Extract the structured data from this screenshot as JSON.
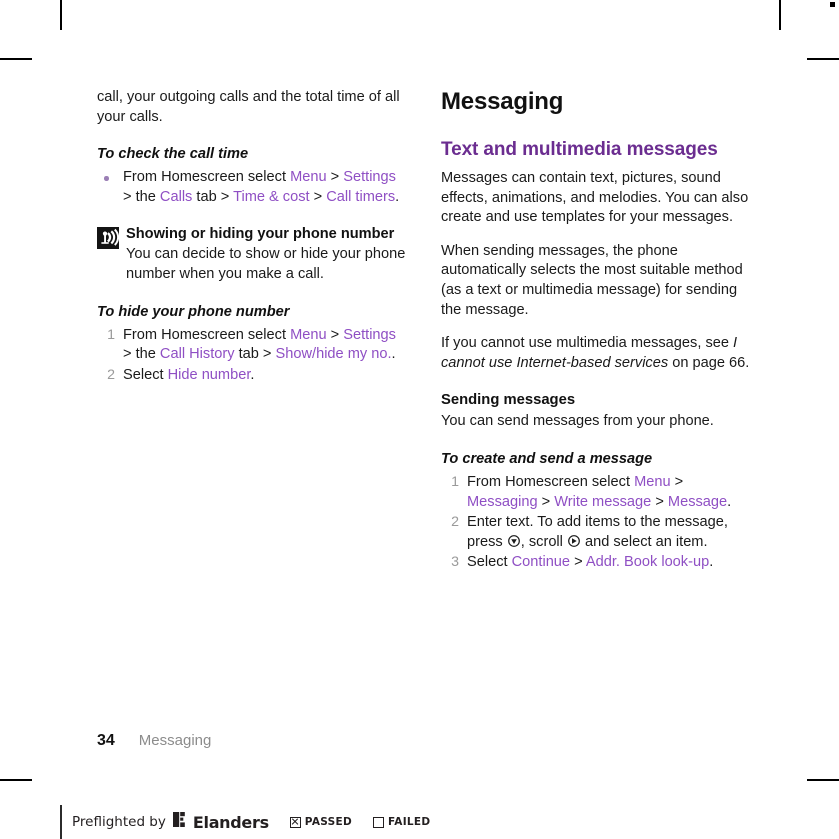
{
  "page": {
    "folio": "34",
    "running_head": "Messaging"
  },
  "colors": {
    "link": "#8f4fc4",
    "heading_purple": "#6b2d90",
    "body": "#1a1a1a",
    "muted": "#8c8c8c"
  },
  "left_column": {
    "continued_paragraph": "call, your outgoing calls and the total time of all your calls.",
    "procedure_1": {
      "title": "To check the call time",
      "bullets": [
        {
          "parts": [
            {
              "text": "From Homescreen select ",
              "style": "plain"
            },
            {
              "text": "Menu",
              "style": "link"
            },
            {
              "text": " > ",
              "style": "plain"
            },
            {
              "text": "Settings",
              "style": "link"
            },
            {
              "text": " > the ",
              "style": "plain"
            },
            {
              "text": "Calls",
              "style": "link"
            },
            {
              "text": " tab > ",
              "style": "plain"
            },
            {
              "text": "Time & cost",
              "style": "link"
            },
            {
              "text": " > ",
              "style": "plain"
            },
            {
              "text": "Call timers",
              "style": "link"
            },
            {
              "text": ".",
              "style": "plain"
            }
          ]
        }
      ]
    },
    "note": {
      "icon": "signal-broadcast-icon",
      "heading": "Showing or hiding your phone number",
      "body": "You can decide to show or hide your phone number when you make a call."
    },
    "procedure_2": {
      "title": "To hide your phone number",
      "steps": [
        {
          "number": "1",
          "parts": [
            {
              "text": "From Homescreen select ",
              "style": "plain"
            },
            {
              "text": "Menu",
              "style": "link"
            },
            {
              "text": " > ",
              "style": "plain"
            },
            {
              "text": "Settings",
              "style": "link"
            },
            {
              "text": " > the ",
              "style": "plain"
            },
            {
              "text": "Call History",
              "style": "link"
            },
            {
              "text": " tab > ",
              "style": "plain"
            },
            {
              "text": "Show/hide my no.",
              "style": "link"
            },
            {
              "text": ".",
              "style": "plain"
            }
          ]
        },
        {
          "number": "2",
          "parts": [
            {
              "text": "Select ",
              "style": "plain"
            },
            {
              "text": "Hide number",
              "style": "link"
            },
            {
              "text": ".",
              "style": "plain"
            }
          ]
        }
      ]
    }
  },
  "right_column": {
    "chapter_title": "Messaging",
    "section_title": "Text and multimedia messages",
    "paragraphs": [
      "Messages can contain text, pictures, sound effects, animations, and melodies. You can also create and use templates for your messages.",
      "When sending messages, the phone automatically selects the most suitable method (as a text or multimedia message) for sending the message."
    ],
    "cross_reference": {
      "lead_in": "If you cannot use multimedia messages, see ",
      "italic_title": "I cannot use Internet-based services",
      "tail": " on page 66."
    },
    "sub_section": {
      "title": "Sending messages",
      "body": "You can send messages from your phone."
    },
    "procedure": {
      "title": "To create and send a message",
      "steps": [
        {
          "number": "1",
          "parts": [
            {
              "text": "From Homescreen select ",
              "style": "plain"
            },
            {
              "text": "Menu",
              "style": "link"
            },
            {
              "text": " > ",
              "style": "plain"
            },
            {
              "text": "Messaging",
              "style": "link"
            },
            {
              "text": " > ",
              "style": "plain"
            },
            {
              "text": "Write message",
              "style": "link"
            },
            {
              "text": " > ",
              "style": "plain"
            },
            {
              "text": "Message",
              "style": "link"
            },
            {
              "text": ".",
              "style": "plain"
            }
          ]
        },
        {
          "number": "2",
          "parts": [
            {
              "text": "Enter text. To add items to the message, press ",
              "style": "plain"
            },
            {
              "icon": "nav-key-down-icon"
            },
            {
              "text": ", scroll ",
              "style": "plain"
            },
            {
              "icon": "nav-key-right-icon"
            },
            {
              "text": " and select an item.",
              "style": "plain"
            }
          ]
        },
        {
          "number": "3",
          "parts": [
            {
              "text": "Select ",
              "style": "plain"
            },
            {
              "text": "Continue",
              "style": "link"
            },
            {
              "text": " > ",
              "style": "plain"
            },
            {
              "text": "Addr. Book look-up",
              "style": "link"
            },
            {
              "text": ".",
              "style": "plain"
            }
          ]
        }
      ]
    }
  },
  "preflight": {
    "label": "Preflighted by",
    "brand": "Elanders",
    "passed_label": "PASSED",
    "failed_label": "FAILED",
    "passed_checked": true,
    "failed_checked": false
  }
}
